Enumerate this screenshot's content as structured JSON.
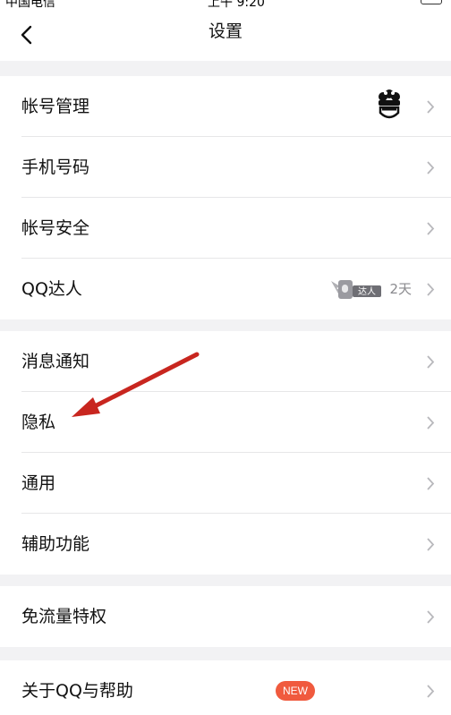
{
  "status_bar": {
    "carrier": "中国电信",
    "time": "上午 9:20"
  },
  "nav": {
    "title": "设置",
    "back_icon": "chevron-left-icon"
  },
  "groups": [
    {
      "rows": [
        {
          "label": "帐号管理",
          "accessory": "avatar"
        },
        {
          "label": "手机号码"
        },
        {
          "label": "帐号安全"
        },
        {
          "label": "QQ达人",
          "badge_text": "达人",
          "days": "2天"
        }
      ]
    },
    {
      "rows": [
        {
          "label": "消息通知"
        },
        {
          "label": "隐私"
        },
        {
          "label": "通用"
        },
        {
          "label": "辅助功能"
        }
      ]
    },
    {
      "rows": [
        {
          "label": "免流量特权"
        }
      ]
    },
    {
      "rows": [
        {
          "label": "关于QQ与帮助",
          "new_badge": "NEW"
        }
      ]
    }
  ],
  "colors": {
    "background": "#f2f2f4",
    "row": "#ffffff",
    "text": "#111111",
    "secondary_text": "#8a8a8e",
    "chevron": "#b8b8bc",
    "new_badge": "#f05a3e",
    "annotation_arrow": "#c8261f"
  },
  "annotation": {
    "type": "arrow",
    "points_to": "隐私"
  }
}
